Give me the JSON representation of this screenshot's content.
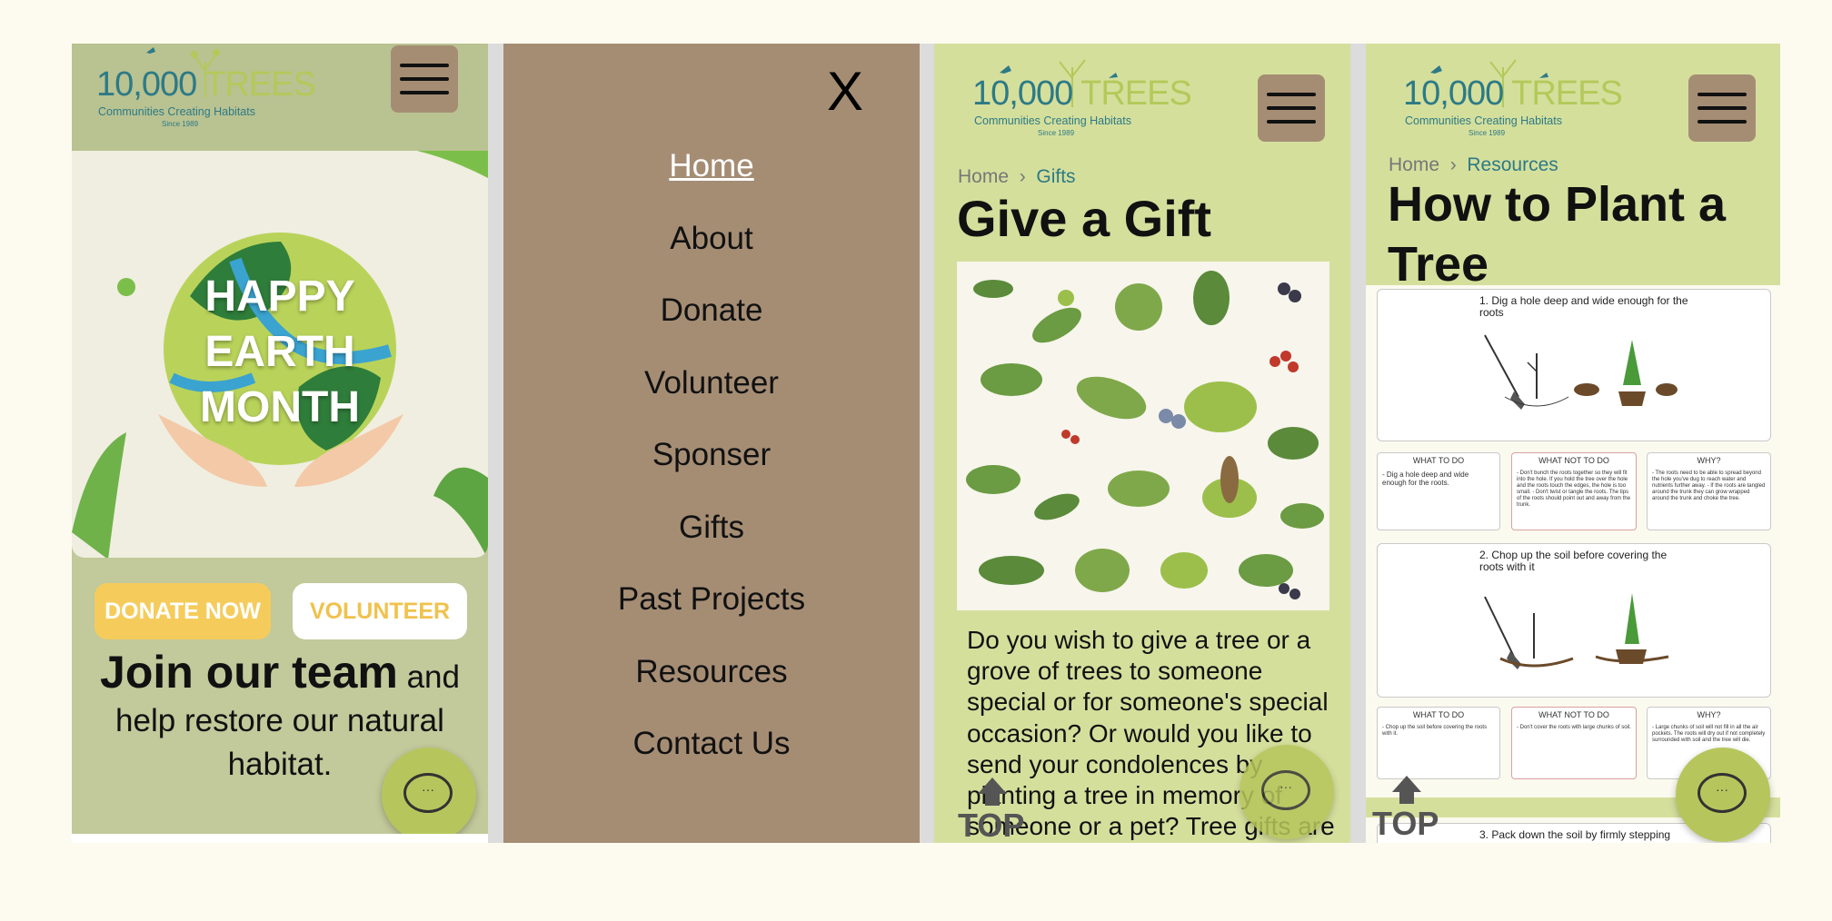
{
  "logo": {
    "number": "10,000",
    "trees": "TREES",
    "tagline": "Communities Creating Habitats",
    "since": "Since 1989"
  },
  "home_screen": {
    "hero_lines": [
      "HAPPY",
      "EARTH",
      "MONTH"
    ],
    "donate_button": "DONATE NOW",
    "volunteer_button": "VOLUNTEER",
    "join_bold": "Join our team",
    "join_rest": " and help restore our natural habitat."
  },
  "menu_screen": {
    "close_label": "X",
    "items": [
      "Home",
      "About",
      "Donate",
      "Volunteer",
      "Sponser",
      "Gifts",
      "Past Projects",
      "Resources",
      "Contact Us"
    ]
  },
  "gifts_screen": {
    "breadcrumb_home": "Home",
    "breadcrumb_sep": "›",
    "breadcrumb_current": "Gifts",
    "title": "Give a Gift",
    "body": "Do you wish to give a tree or a grove of trees to someone special or for someone's special occasion? Or would you like to send your condolences by planting a tree in memory of someone or a pet? Tree gifts are a unique and lasting"
  },
  "resources_screen": {
    "breadcrumb_home": "Home",
    "breadcrumb_sep": "›",
    "breadcrumb_current": "Resources",
    "title_line1": "How to Plant a",
    "title_line2": "Tree",
    "steps": [
      {
        "caption": "1. Dig a hole deep and wide enough for the roots",
        "do_title": "WHAT TO DO",
        "do_text": "- Dig a hole deep and wide enough for the roots.",
        "not_title": "WHAT NOT TO DO",
        "not_text": "- Don't bunch the roots together so they will fit into the hole. If you hold the tree over the hole and the roots touch the edges, the hole is too small. - Don't twist or tangle the roots. The tips of the roots should point out and away from the trunk.",
        "why_title": "WHY?",
        "why_text": "- The roots need to be able to spread beyond the hole you've dug to reach water and nutrients further away. - If the roots are tangled around the trunk they can grow wrapped around the trunk and choke the tree."
      },
      {
        "caption": "2. Chop up the soil before covering the roots with it",
        "do_title": "WHAT TO DO",
        "do_text": "- Chop up the soil before covering the roots with it.",
        "not_title": "WHAT NOT TO DO",
        "not_text": "- Don't cover the roots with large chunks of soil.",
        "why_title": "WHY?",
        "why_text": "- Large chunks of soil will not fill in all the air pockets. The roots will dry out if not completely surrounded with soil and the tree will die."
      }
    ],
    "step3_caption": "3. Pack down the soil by firmly stepping"
  },
  "top_label": "TOP",
  "chat_dots": "···",
  "colors": {
    "teal": "#2d7a86",
    "leaf": "#b3c95a",
    "menu_bg": "#a58d74",
    "panel_green": "#d5df9c",
    "donate_yellow": "#f5cc5c"
  }
}
